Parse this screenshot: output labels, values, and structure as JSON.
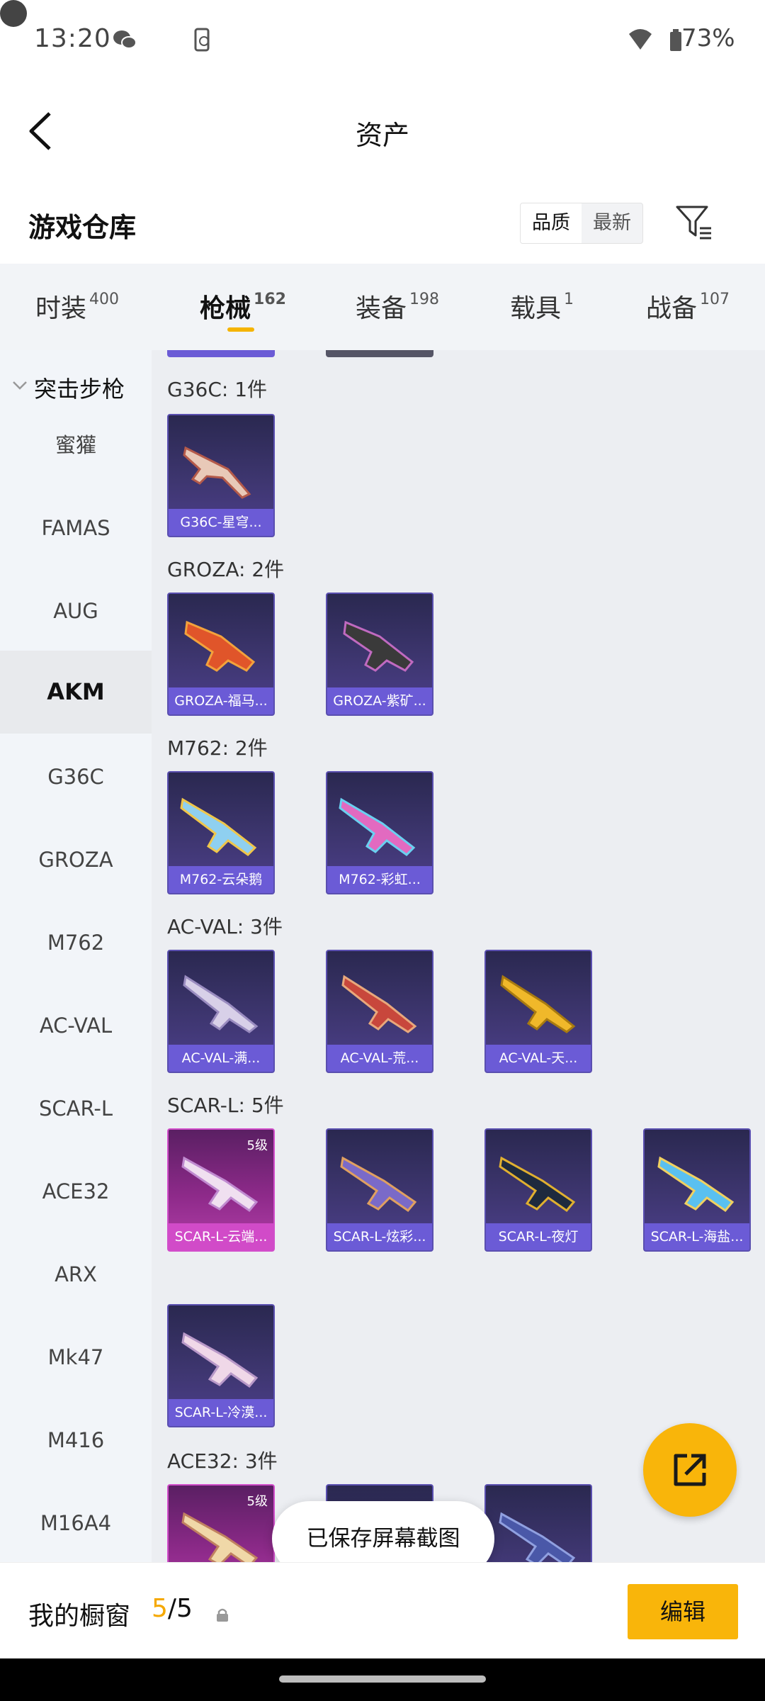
{
  "status_bar": {
    "time": "13:20",
    "battery": "73%"
  },
  "nav": {
    "title": "资产"
  },
  "warehouse": {
    "title": "游戏仓库",
    "sort_options": [
      "品质",
      "最新"
    ],
    "sort_selected": "品质"
  },
  "tabs": [
    {
      "label": "时装",
      "count": "400"
    },
    {
      "label": "枪械",
      "count": "162",
      "active": true
    },
    {
      "label": "装备",
      "count": "198"
    },
    {
      "label": "载具",
      "count": "1"
    },
    {
      "label": "战备",
      "count": "107"
    }
  ],
  "sidebar": {
    "category": "突击步枪",
    "items": [
      "蜜獾",
      "FAMAS",
      "AUG",
      "AKM",
      "G36C",
      "GROZA",
      "M762",
      "AC-VAL",
      "SCAR-L",
      "ACE32",
      "ARX",
      "Mk47",
      "M416",
      "M16A4"
    ],
    "active": "AKM"
  },
  "sections": [
    {
      "title": "G36C: 1件",
      "items": [
        {
          "name": "G36C-星穹...",
          "rarity": "purple"
        }
      ]
    },
    {
      "title": "GROZA: 2件",
      "items": [
        {
          "name": "GROZA-福马...",
          "rarity": "purple"
        },
        {
          "name": "GROZA-紫矿...",
          "rarity": "purple"
        }
      ]
    },
    {
      "title": "M762: 2件",
      "items": [
        {
          "name": "M762-云朵鹅",
          "rarity": "purple"
        },
        {
          "name": "M762-彩虹...",
          "rarity": "purple"
        }
      ]
    },
    {
      "title": "AC-VAL: 3件",
      "items": [
        {
          "name": "AC-VAL-满...",
          "rarity": "purple"
        },
        {
          "name": "AC-VAL-荒...",
          "rarity": "purple"
        },
        {
          "name": "AC-VAL-天...",
          "rarity": "purple"
        }
      ]
    },
    {
      "title": "SCAR-L: 5件",
      "items": [
        {
          "name": "SCAR-L-云端...",
          "rarity": "pink",
          "level": "5级"
        },
        {
          "name": "SCAR-L-炫彩...",
          "rarity": "purple"
        },
        {
          "name": "SCAR-L-夜灯",
          "rarity": "purple"
        },
        {
          "name": "SCAR-L-海盐...",
          "rarity": "purple"
        },
        {
          "name": "SCAR-L-冷漠...",
          "rarity": "purple"
        }
      ]
    },
    {
      "title": "ACE32: 3件",
      "items": [
        {
          "name": "",
          "rarity": "pink",
          "level": "5级"
        },
        {
          "name": "",
          "rarity": "purple"
        },
        {
          "name": "",
          "rarity": "purple"
        }
      ]
    }
  ],
  "toast": "已保存屏幕截图",
  "bottom_bar": {
    "showcase_label": "我的橱窗",
    "showcase_current": "5",
    "showcase_total": "/5",
    "edit_label": "编辑"
  },
  "colors": {
    "accent": "#f9b50a",
    "card_purple": "#6b5bd6",
    "card_pink": "#d14bc8"
  }
}
